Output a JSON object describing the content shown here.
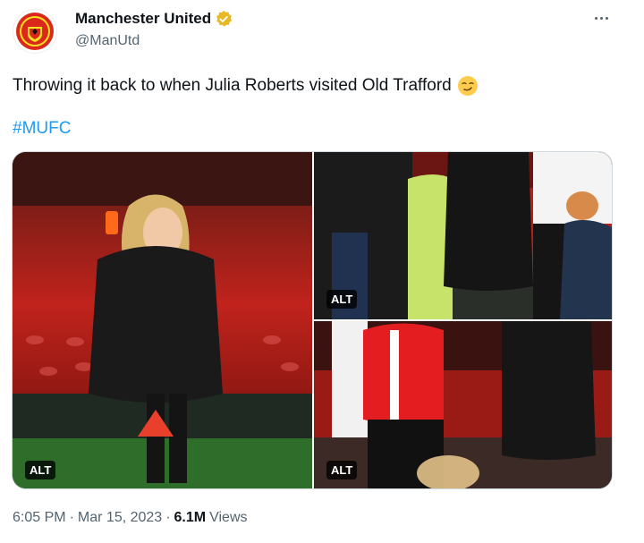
{
  "author": {
    "display_name": "Manchester United",
    "handle": "@ManUtd",
    "verified_color": "#e8b923"
  },
  "tweet": {
    "text": "Throwing it back to when Julia Roberts visited Old Trafford",
    "emoji": "smirk-emoji",
    "hashtag": "#MUFC"
  },
  "media": [
    {
      "alt_label": "ALT",
      "description_icon": "photo-woman-filming-on-phone"
    },
    {
      "alt_label": "ALT",
      "description_icon": "photo-crowd-on-pitch"
    },
    {
      "alt_label": "ALT",
      "description_icon": "photo-boy-in-red-shirt"
    }
  ],
  "meta": {
    "time": "6:05 PM",
    "separator": "·",
    "date": "Mar 15, 2023",
    "views_count": "6.1M",
    "views_label": "Views"
  },
  "colors": {
    "link": "#1d9bf0",
    "text": "#0f1419",
    "muted": "#536471",
    "club_red": "#da291c"
  }
}
